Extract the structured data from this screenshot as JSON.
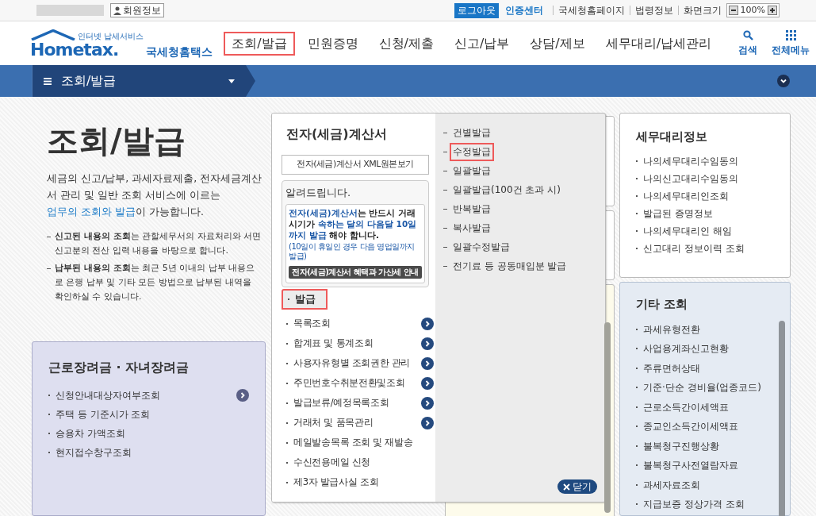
{
  "top_bar": {
    "member_button": "회원정보",
    "logout": "로그아웃",
    "cert": "인증센터",
    "links": [
      "국세청홈페이지",
      "법령정보"
    ],
    "zoom_label": "화면크기",
    "zoom_value": "100%"
  },
  "header": {
    "logo": {
      "tagline": "인터넷 납세서비스",
      "wordmark": "Hometax.",
      "name": "국세청홈택스"
    },
    "nav": [
      {
        "label": "조회/발급",
        "selected": true
      },
      {
        "label": "민원증명",
        "selected": false
      },
      {
        "label": "신청/제출",
        "selected": false
      },
      {
        "label": "신고/납부",
        "selected": false
      },
      {
        "label": "상담/제보",
        "selected": false
      },
      {
        "label": "세무대리/납세관리",
        "selected": false
      }
    ],
    "tools": [
      {
        "kind": "search",
        "label": "검색"
      },
      {
        "kind": "menu",
        "label": "전체메뉴"
      }
    ]
  },
  "breadcrumb": {
    "label": "조회/발급"
  },
  "intro": {
    "title": "조회/발급",
    "description": [
      {
        "kind": "plain",
        "text": "세금의 신고/납부, 과세자료제출, 전자세금계산서 관리 및 일반 조회 서비스에 이르는 "
      },
      {
        "kind": "link",
        "text": "업무의 조회와 발급"
      },
      {
        "kind": "plain",
        "text": "이 가능합니다."
      }
    ],
    "notes": [
      "**신고된 내용의 조회**는 관할세무서의 자료처리와 서면신고분의 전산 입력 내용을 바탕으로 합니다.",
      "**납부된 내용의 조회**는 최근 5년 이내의 납부 내용으로 은행 납부 및 기타 모든 방법으로 납부된 내역을 확인하실 수 있습니다."
    ]
  },
  "incentive_card": {
    "title": "근로장려금 · 자녀장려금",
    "items": [
      {
        "label": "신청안내대상자여부조회",
        "arrow": true
      },
      {
        "label": "주택 등 기준시가 조회",
        "arrow": false
      },
      {
        "label": "승용차 가액조회",
        "arrow": false
      },
      {
        "label": "현지접수창구조회",
        "arrow": false
      }
    ]
  },
  "popup": {
    "title": "전자(세금)계산서",
    "xml_button": "전자(세금)계산서 XML원본보기",
    "notice": {
      "title": "알려드립니다.",
      "body": [
        {
          "kind": "blue",
          "text": "전자(세금)계산서"
        },
        {
          "kind": "plain",
          "text": "는 반드시 거래시기가 "
        },
        {
          "kind": "blue",
          "text": "속하는 달의 다음달 10일까지 발급"
        },
        {
          "kind": "plain",
          "text": " 해야 합니다."
        }
      ],
      "note": "(10일이 휴일인 경우 다음 영업일까지 발급)",
      "button": "전자(세금)계산서 혜택과 가산세 안내"
    },
    "tab": {
      "label": "발급",
      "selected": true,
      "highlighted": true
    },
    "items": [
      {
        "label": "목록조회",
        "arrow": true
      },
      {
        "label": "합계표 및 통계조회",
        "arrow": true
      },
      {
        "label": "사용자유형별 조회권한 관리",
        "arrow": true
      },
      {
        "label": "주민번호수취분전환및조회",
        "arrow": true
      },
      {
        "label": "발급보류/예정목록조회",
        "arrow": true
      },
      {
        "label": "거래처 및 품목관리",
        "arrow": true
      },
      {
        "label": "메일발송목록 조회 및 재발송",
        "arrow": false
      },
      {
        "label": "수신전용메일 신청",
        "arrow": false
      },
      {
        "label": "제3자 발급사실 조회",
        "arrow": false
      }
    ],
    "submenu": [
      {
        "label": "건별발급",
        "highlighted": false
      },
      {
        "label": "수정발급",
        "highlighted": true
      },
      {
        "label": "일괄발급",
        "highlighted": false
      },
      {
        "label": "일괄발급(100건 초과 시)",
        "highlighted": false
      },
      {
        "label": "반복발급",
        "highlighted": false
      },
      {
        "label": "복사발급",
        "highlighted": false
      },
      {
        "label": "일괄수정발급",
        "highlighted": false
      },
      {
        "label": "전기료 등 공동매입분 발급",
        "highlighted": false
      }
    ],
    "close": "닫기"
  },
  "agent_card": {
    "title": "세무대리정보",
    "items": [
      "나의세무대리수임동의",
      "나의신고대리수임동의",
      "나의세무대리인조회",
      "발급된 증명정보",
      "나의세무대리인 해임",
      "신고대리 정보이력 조회"
    ]
  },
  "other_card": {
    "title": "기타 조회",
    "items": [
      "과세유형전환",
      "사업용계좌신고현황",
      "주류면허상태",
      "기준·단순 경비율(업종코드)",
      "근로소득간이세액표",
      "종교인소득간이세액표",
      "불복청구진행상황",
      "불복청구사전열람자료",
      "과세자료조회",
      "지급보증 정상가격 조회"
    ]
  }
}
